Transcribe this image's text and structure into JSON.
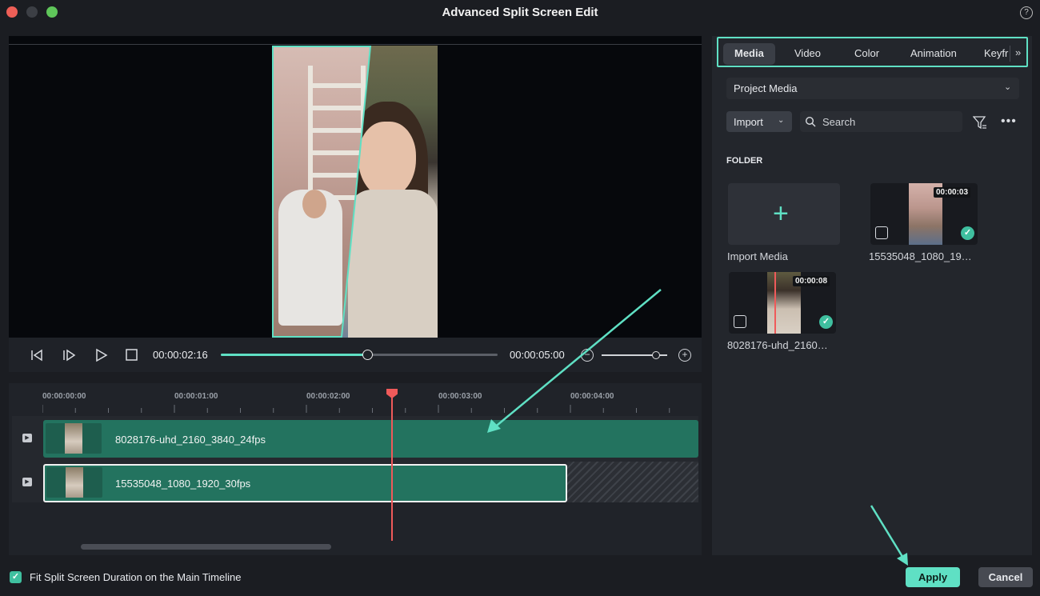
{
  "window": {
    "title": "Advanced Split Screen Edit"
  },
  "colors": {
    "accent": "#5fe0c4",
    "playhead": "#ef5a5a",
    "clip": "#23735f"
  },
  "player": {
    "current_time": "00:00:02:16",
    "total_time": "00:00:05:00",
    "progress": 0.53
  },
  "timeline": {
    "ticks": [
      "00:00:00:00",
      "00:00:01:00",
      "00:00:02:00",
      "00:00:03:00",
      "00:00:04:00"
    ],
    "tracks": [
      {
        "clip_name": "8028176-uhd_2160_3840_24fps"
      },
      {
        "clip_name": "15535048_1080_1920_30fps"
      }
    ]
  },
  "panel": {
    "tabs": [
      "Media",
      "Video",
      "Color",
      "Animation",
      "Keyfr"
    ],
    "active_tab": "Media",
    "more_tabs": "»",
    "media_source": "Project Media",
    "import_label": "Import",
    "search_placeholder": "Search",
    "folder_label": "FOLDER",
    "import_media_label": "Import Media",
    "media": [
      {
        "name": "15535048_1080_19…",
        "duration": "00:00:03"
      },
      {
        "name": "8028176-uhd_2160…",
        "duration": "00:00:08"
      }
    ]
  },
  "footer": {
    "fit_label": "Fit Split Screen Duration on the Main Timeline",
    "apply_label": "Apply",
    "cancel_label": "Cancel"
  },
  "icons": [
    "close-icon",
    "minimize-icon",
    "zoom-icon",
    "help-icon",
    "prev-frame-icon",
    "next-frame-icon",
    "play-icon",
    "stop-icon",
    "zoom-out-icon",
    "zoom-in-icon",
    "search-icon",
    "filter-icon",
    "more-icon",
    "plus-icon",
    "video-icon",
    "check-icon"
  ]
}
